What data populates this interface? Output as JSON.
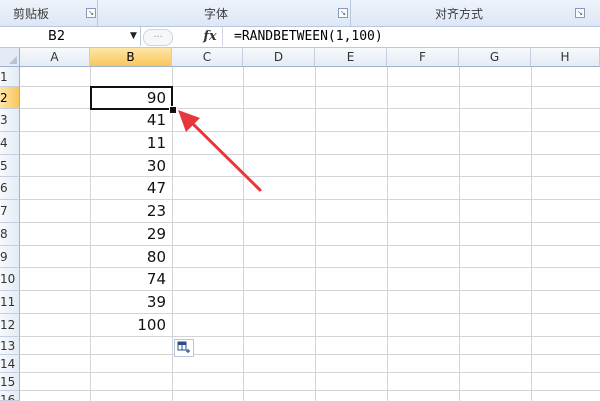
{
  "ribbon": {
    "groups": [
      {
        "label": "剪贴板"
      },
      {
        "label": "字体"
      },
      {
        "label": "对齐方式"
      }
    ]
  },
  "formula_bar": {
    "name_box": "B2",
    "fx_label": "fx",
    "formula": "=RANDBETWEEN(1,100)"
  },
  "columns": [
    "A",
    "B",
    "C",
    "D",
    "E",
    "F",
    "G",
    "H"
  ],
  "rows": [
    "1",
    "2",
    "3",
    "4",
    "5",
    "6",
    "7",
    "8",
    "9",
    "10",
    "11",
    "12",
    "13",
    "14",
    "15",
    "16"
  ],
  "column_b_values": [
    "90",
    "41",
    "11",
    "30",
    "47",
    "23",
    "29",
    "80",
    "74",
    "39",
    "100"
  ],
  "active_cell": "B2",
  "annotation": {
    "color": "#e8373c"
  }
}
